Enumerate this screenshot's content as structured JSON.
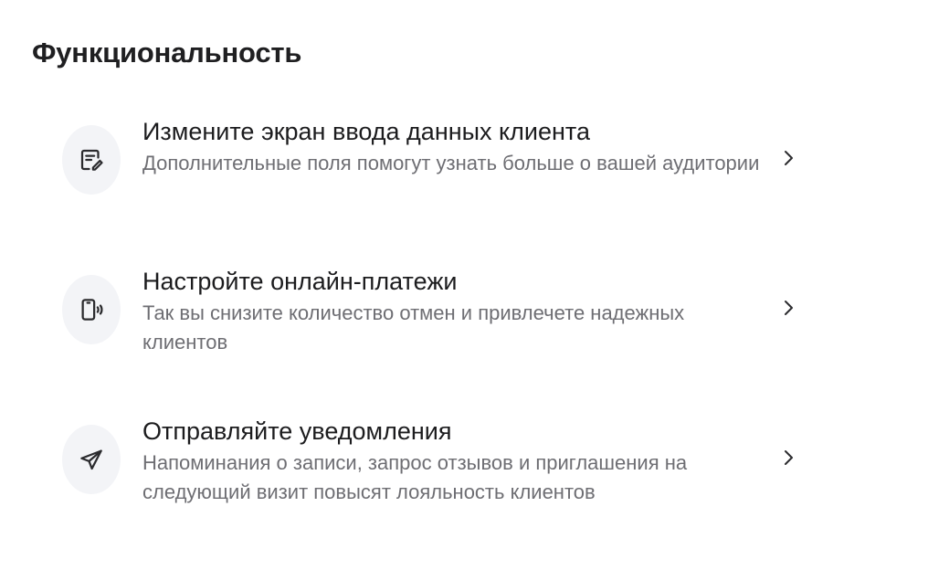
{
  "section": {
    "title": "Функциональность"
  },
  "features": [
    {
      "icon": "edit-form-icon",
      "title": "Измените экран ввода данных клиента",
      "description": "Дополнительные поля помогут узнать больше о вашей аудитории"
    },
    {
      "icon": "contactless-payment-icon",
      "title": "Настройте онлайн-платежи",
      "description": "Так вы снизите количество отмен и привлечете надежных клиентов"
    },
    {
      "icon": "send-icon",
      "title": "Отправляйте уведомления",
      "description": "Напоминания о записи, запрос отзывов и приглашения на следующий визит повысят лояльность клиентов"
    }
  ]
}
